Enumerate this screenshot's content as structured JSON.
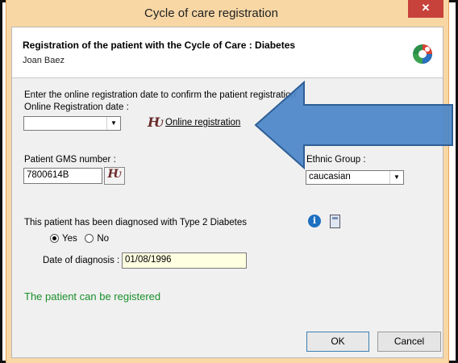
{
  "window": {
    "title": "Cycle of care registration",
    "close_glyph": "✕"
  },
  "header": {
    "title": "Registration of the patient with the Cycle of Care : Diabetes",
    "patient_name": "Joan Baez",
    "logo_icon": "colorful-logo-icon"
  },
  "registration": {
    "instruction": "Enter the online registration date to confirm the patient registration",
    "date_label": "Online Registration date :",
    "date_value": "",
    "hse_glyph": "Ƕ",
    "online_link": "Online registration"
  },
  "gms": {
    "label": "Patient GMS number :",
    "value": "7800614B"
  },
  "ethnic": {
    "label": "Ethnic Group :",
    "value": "caucasian"
  },
  "diagnosis": {
    "question": "This patient has been diagnosed with Type 2 Diabetes",
    "yes_label": "Yes",
    "no_label": "No",
    "selected": "Yes",
    "date_label": "Date of diagnosis :",
    "date_value": "01/08/1996"
  },
  "status": {
    "message": "The patient can be registered",
    "color": "#1a8f2a"
  },
  "buttons": {
    "ok": "OK",
    "cancel": "Cancel"
  },
  "annotation": {
    "arrow_color": "#4a86c8",
    "arrow_icon": "big-blue-arrow"
  }
}
